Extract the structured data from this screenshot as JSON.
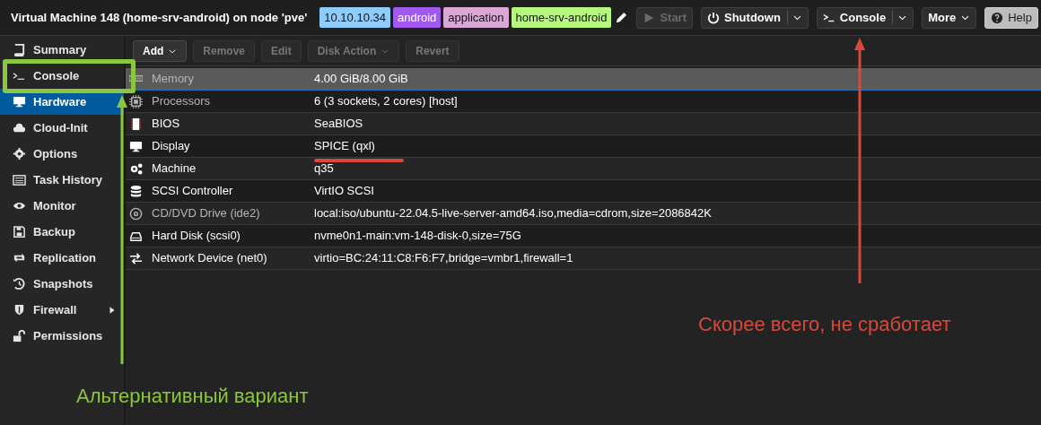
{
  "header": {
    "title": "Virtual Machine 148 (home-srv-android) on node 'pve'",
    "tags": [
      {
        "label": "10.10.10.34",
        "color": "#8fccf9"
      },
      {
        "label": "android",
        "color": "#a259f0"
      },
      {
        "label": "application",
        "color": "#d9a8d6"
      },
      {
        "label": "home-srv-android",
        "color": "#b8f77e"
      }
    ],
    "buttons": [
      {
        "kind": "start",
        "label": "Start",
        "disabled": true,
        "menu": false
      },
      {
        "kind": "shutdown",
        "label": "Shutdown",
        "disabled": false,
        "menu": true
      },
      {
        "kind": "console",
        "label": "Console",
        "disabled": false,
        "menu": true
      },
      {
        "kind": "more",
        "label": "More",
        "disabled": false,
        "menu": true
      },
      {
        "kind": "help",
        "label": "Help",
        "disabled": false,
        "menu": false
      }
    ]
  },
  "sidebar": {
    "items": [
      {
        "kind": "summary",
        "label": "Summary",
        "selected": false
      },
      {
        "kind": "console",
        "label": "Console",
        "selected": false
      },
      {
        "kind": "hardware",
        "label": "Hardware",
        "selected": true
      },
      {
        "kind": "cloud",
        "label": "Cloud-Init",
        "selected": false
      },
      {
        "kind": "options",
        "label": "Options",
        "selected": false
      },
      {
        "kind": "tasks",
        "label": "Task History",
        "selected": false
      },
      {
        "kind": "monitor",
        "label": "Monitor",
        "selected": false
      },
      {
        "kind": "backup",
        "label": "Backup",
        "selected": false
      },
      {
        "kind": "replication",
        "label": "Replication",
        "selected": false
      },
      {
        "kind": "snapshots",
        "label": "Snapshots",
        "selected": false
      },
      {
        "kind": "firewall",
        "label": "Firewall",
        "selected": false,
        "expandable": true
      },
      {
        "kind": "permissions",
        "label": "Permissions",
        "selected": false
      }
    ]
  },
  "toolbar": [
    {
      "label": "Add",
      "disabled": false,
      "menu": true
    },
    {
      "label": "Remove",
      "disabled": true,
      "menu": false
    },
    {
      "label": "Edit",
      "disabled": true,
      "menu": false
    },
    {
      "label": "Disk Action",
      "disabled": true,
      "menu": true
    },
    {
      "label": "Revert",
      "disabled": true,
      "menu": false
    }
  ],
  "hardware": [
    {
      "kind": "memory",
      "name": "Memory",
      "value": "4.00 GiB/8.00 GiB",
      "selected": true,
      "dimmed": true
    },
    {
      "kind": "cpu",
      "name": "Processors",
      "value": "6 (3 sockets, 2 cores) [host]",
      "selected": false,
      "dimmed": true
    },
    {
      "kind": "bios",
      "name": "BIOS",
      "value": "SeaBIOS",
      "selected": false,
      "dimmed": false
    },
    {
      "kind": "display",
      "name": "Display",
      "value": "SPICE (qxl)",
      "selected": false,
      "dimmed": false
    },
    {
      "kind": "machine",
      "name": "Machine",
      "value": "q35",
      "selected": false,
      "dimmed": false
    },
    {
      "kind": "scsi",
      "name": "SCSI Controller",
      "value": "VirtIO SCSI",
      "selected": false,
      "dimmed": false
    },
    {
      "kind": "cdrom",
      "name": "CD/DVD Drive (ide2)",
      "value": "local:iso/ubuntu-22.04.5-live-server-amd64.iso,media=cdrom,size=2086842K",
      "selected": false,
      "dimmed": true
    },
    {
      "kind": "disk",
      "name": "Hard Disk (scsi0)",
      "value": "nvme0n1-main:vm-148-disk-0,size=75G",
      "selected": false,
      "dimmed": false
    },
    {
      "kind": "network",
      "name": "Network Device (net0)",
      "value": "virtio=BC:24:11:C8:F6:F7,bridge=vmbr1,firewall=1",
      "selected": false,
      "dimmed": false
    }
  ],
  "annotations": [
    {
      "kind": "red",
      "text": "Скорее всего, не сработает",
      "color": "#d9493b"
    },
    {
      "kind": "green",
      "text": "Альтернативный вариант",
      "color": "#8cc63f"
    }
  ]
}
